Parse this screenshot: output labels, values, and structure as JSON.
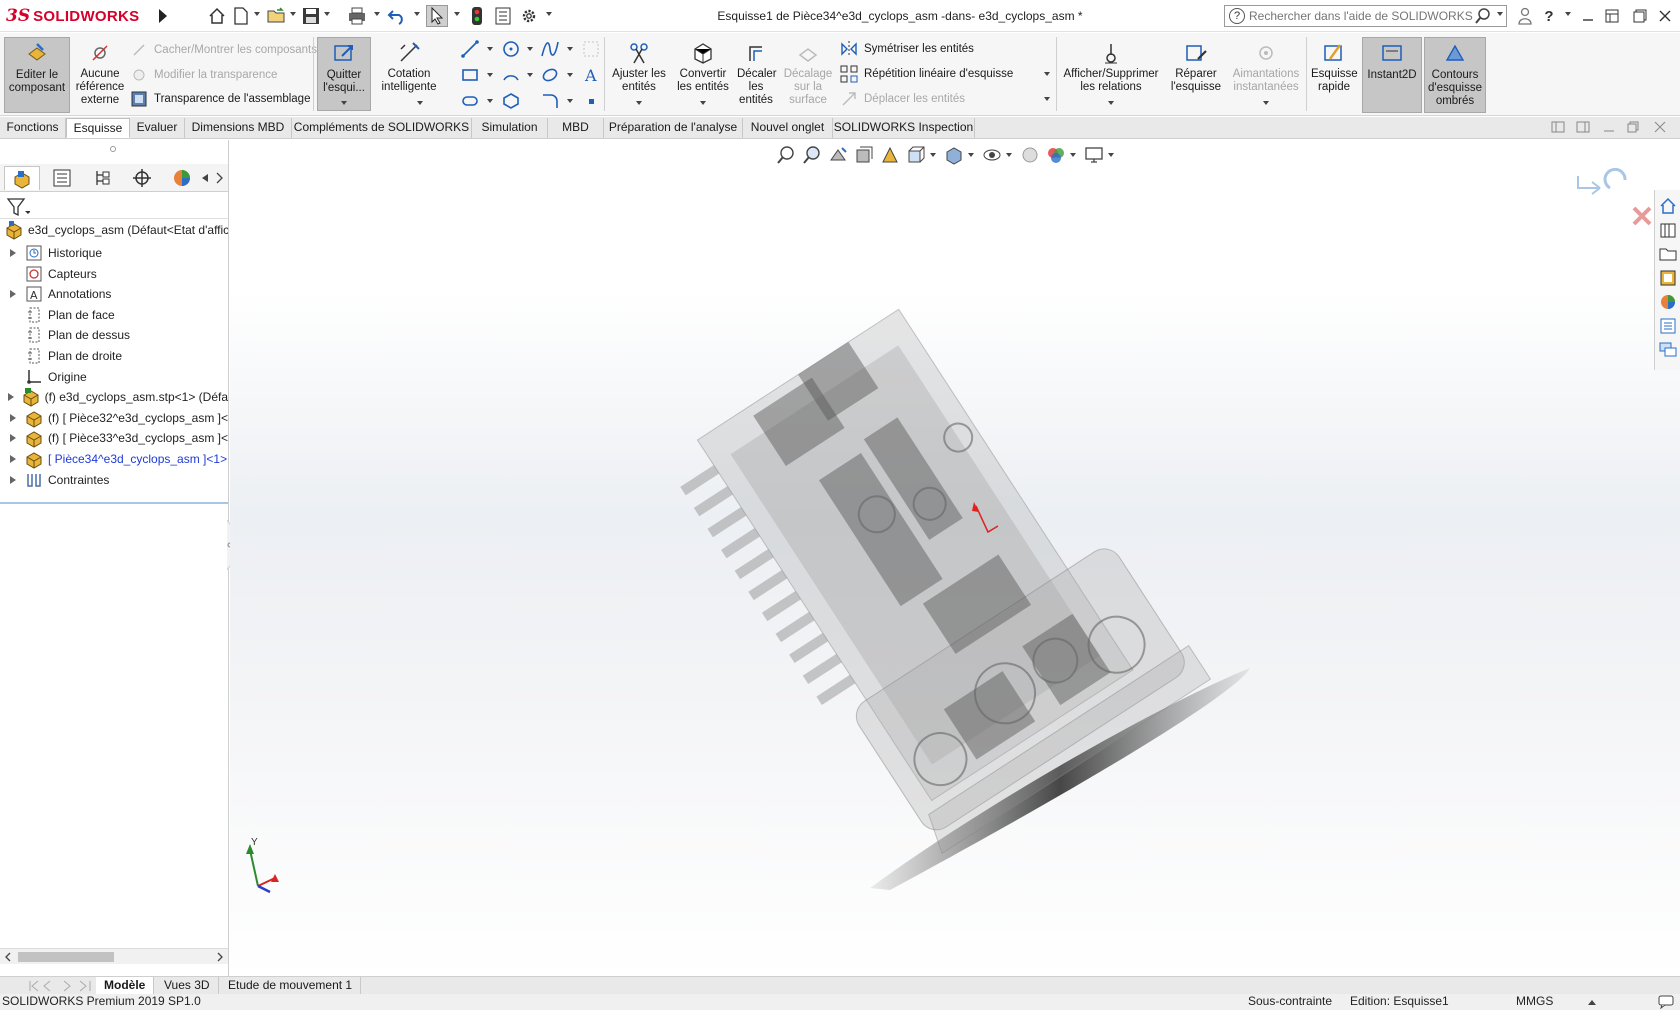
{
  "app": {
    "brand_ds": "3S",
    "brand_name": "SOLIDWORKS",
    "doc_title": "Esquisse1 de Pièce34^e3d_cyclops_asm -dans- e3d_cyclops_asm *",
    "search_placeholder": "Rechercher dans l'aide de SOLIDWORKS",
    "help_label": "?"
  },
  "command_manager": {
    "edit_component": "Editer le composant",
    "no_external_ref": "Aucune référence externe",
    "hide_show": "Cacher/Montrer les composants",
    "modify_transparency": "Modifier la transparence",
    "assembly_transparency": "Transparence de l'assemblage",
    "exit_sketch": "Quitter l'esqui...",
    "smart_dimension": "Cotation intelligente",
    "trim_entities": "Ajuster les entités",
    "convert_entities": "Convertir les entités",
    "offset_entities": "Décaler les entités",
    "offset_surface": "Décalage sur la surface",
    "mirror_entities": "Symétriser les entités",
    "linear_pattern": "Répétition linéaire d'esquisse",
    "move_entities": "Déplacer les entités",
    "display_relations": "Afficher/Supprimer les relations",
    "repair_sketch": "Réparer l'esquisse",
    "quick_snaps": "Aimantations instantanées",
    "rapid_sketch": "Esquisse rapide",
    "instant2d": "Instant2D",
    "shaded_contours": "Contours d'esquisse ombrés"
  },
  "tabs": [
    {
      "label": "Fonctions"
    },
    {
      "label": "Esquisse",
      "active": true
    },
    {
      "label": "Evaluer"
    },
    {
      "label": "Dimensions MBD"
    },
    {
      "label": "Compléments de SOLIDWORKS"
    },
    {
      "label": "Simulation"
    },
    {
      "label": "MBD"
    },
    {
      "label": "Préparation de l'analyse"
    },
    {
      "label": "Nouvel onglet"
    },
    {
      "label": "SOLIDWORKS Inspection"
    }
  ],
  "tree": {
    "root": "e3d_cyclops_asm  (Défaut<Etat d'affic",
    "items": [
      {
        "label": "Historique",
        "icon": "history-icon",
        "expandable": true
      },
      {
        "label": "Capteurs",
        "icon": "sensor-icon",
        "expandable": false
      },
      {
        "label": "Annotations",
        "icon": "annotations-icon",
        "expandable": true
      },
      {
        "label": "Plan de face",
        "icon": "plane-icon",
        "expandable": false
      },
      {
        "label": "Plan de dessus",
        "icon": "plane-icon",
        "expandable": false
      },
      {
        "label": "Plan de droite",
        "icon": "plane-icon",
        "expandable": false
      },
      {
        "label": "Origine",
        "icon": "origin-icon",
        "expandable": false
      },
      {
        "label": "(f) e3d_cyclops_asm.stp<1> (Défa",
        "icon": "subassembly-icon",
        "expandable": true
      },
      {
        "label": "(f) [ Pièce32^e3d_cyclops_asm ]<",
        "icon": "part-icon",
        "expandable": true
      },
      {
        "label": "(f) [ Pièce33^e3d_cyclops_asm ]<",
        "icon": "part-icon",
        "expandable": true
      },
      {
        "label": "[ Pièce34^e3d_cyclops_asm ]<1>",
        "icon": "part-icon",
        "expandable": true,
        "editing": true
      },
      {
        "label": "Contraintes",
        "icon": "mates-icon",
        "expandable": true
      }
    ]
  },
  "bottom_tabs": [
    {
      "label": "Modèle",
      "active": true
    },
    {
      "label": "Vues 3D"
    },
    {
      "label": "Etude de mouvement 1"
    }
  ],
  "status": {
    "version": "SOLIDWORKS Premium 2019 SP1.0",
    "constraint": "Sous-contrainte",
    "editing": "Edition: Esquisse1",
    "units": "MMGS"
  },
  "triad": {
    "y_label": "Y"
  },
  "colors": {
    "brand_red": "#d6002a",
    "accent_blue": "#1f3ad6",
    "active_tab_bg": "#c6c6c6"
  }
}
